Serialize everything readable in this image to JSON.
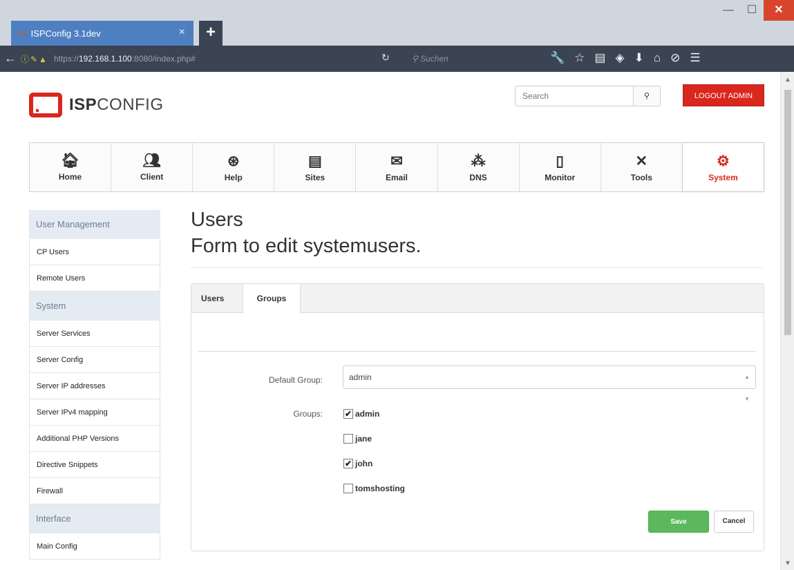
{
  "browser": {
    "tab_title": "ISPConfig 3.1dev",
    "tab_close": "×",
    "new_tab": "+",
    "window": {
      "minimize": "—",
      "maximize": "☐",
      "close": "✕"
    },
    "url_scheme": "https://",
    "url_host": "192.168.1.100",
    "url_rest": ":8080/index.php#",
    "search_placeholder": "Suchen",
    "toolbar_icons": [
      "wrench-icon",
      "star-icon",
      "reading-list-icon",
      "pocket-icon",
      "download-icon",
      "home-icon",
      "extension-icon",
      "menu-icon"
    ]
  },
  "header": {
    "logo_bold": "ISP",
    "logo_rest": "CONFIG",
    "search_placeholder": "Search",
    "search_button_icon": "search-icon",
    "logout_label": "LOGOUT ADMIN"
  },
  "modules": [
    {
      "label": "Home",
      "icon": "home-icon"
    },
    {
      "label": "Client",
      "icon": "users-icon"
    },
    {
      "label": "Help",
      "icon": "lifebuoy-icon"
    },
    {
      "label": "Sites",
      "icon": "browser-window-icon"
    },
    {
      "label": "Email",
      "icon": "envelope-icon"
    },
    {
      "label": "DNS",
      "icon": "network-icon"
    },
    {
      "label": "Monitor",
      "icon": "traffic-light-icon"
    },
    {
      "label": "Tools",
      "icon": "tools-icon"
    },
    {
      "label": "System",
      "icon": "gear-icon",
      "active": true
    }
  ],
  "sidebar": {
    "user_management": "User Management",
    "cp_users": "CP Users",
    "remote_users": "Remote Users",
    "system": "System",
    "server_services": "Server Services",
    "server_config": "Server Config",
    "server_ip": "Server IP addresses",
    "server_ipv4": "Server IPv4 mapping",
    "php_versions": "Additional PHP Versions",
    "directive_snippets": "Directive Snippets",
    "firewall": "Firewall",
    "interface": "Interface",
    "main_config": "Main Config"
  },
  "main": {
    "title": "Users",
    "subtitle": "Form to edit systemusers.",
    "tabs": {
      "users": "Users",
      "groups": "Groups"
    },
    "default_group_label": "Default Group:",
    "default_group_value": "admin",
    "groups_label": "Groups:",
    "groups": [
      {
        "name": "admin",
        "checked": true
      },
      {
        "name": "jane",
        "checked": false
      },
      {
        "name": "john",
        "checked": true
      },
      {
        "name": "tomshosting",
        "checked": false
      }
    ],
    "save_label": "Save",
    "cancel_label": "Cancel"
  },
  "colors": {
    "accent": "#d9271e",
    "save": "#5cb85c",
    "sidebar_head": "#e4ebf3",
    "browser_chrome": "#3a4452",
    "tab": "#4e7fc1"
  }
}
